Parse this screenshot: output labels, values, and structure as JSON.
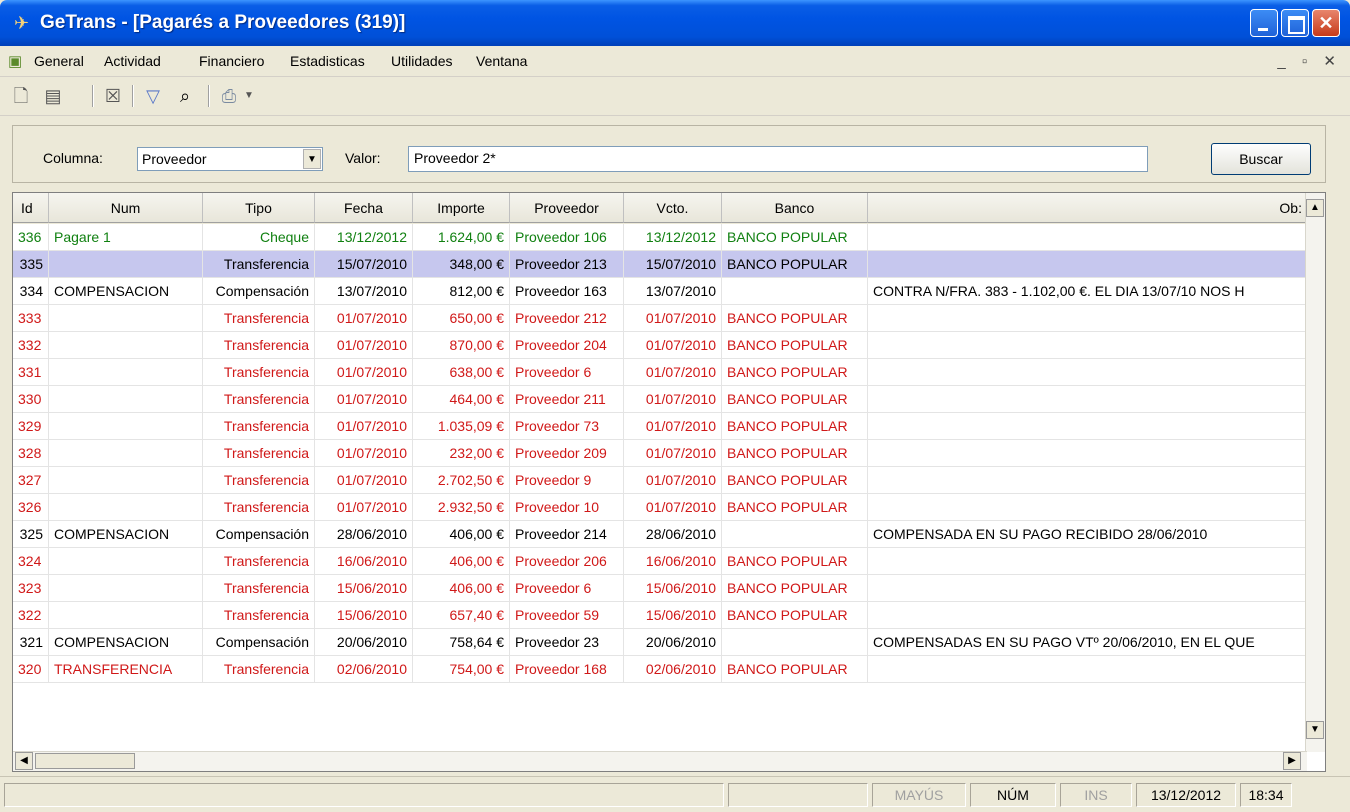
{
  "window": {
    "title": "GeTrans - [Pagarés a Proveedores (319)]"
  },
  "menu": [
    "General",
    "Actividad",
    "Financiero",
    "Estadisticas",
    "Utilidades",
    "Ventana"
  ],
  "search": {
    "column_label": "Columna:",
    "column_value": "Proveedor",
    "value_label": "Valor:",
    "value_text": "Proveedor 2*",
    "button": "Buscar"
  },
  "grid": {
    "headers": [
      "Id",
      "Num",
      "Tipo",
      "Fecha",
      "Importe",
      "Proveedor",
      "Vcto.",
      "Banco",
      "Ob:"
    ],
    "rows": [
      {
        "id": "336",
        "num": "Pagare 1",
        "tipo": "Cheque",
        "fecha": "13/12/2012",
        "importe": "1.624,00 €",
        "proveedor": "Proveedor 106",
        "vcto": "13/12/2012",
        "banco": "BANCO POPULAR",
        "obs": "",
        "color": "green"
      },
      {
        "id": "335",
        "num": "",
        "tipo": "Transferencia",
        "fecha": "15/07/2010",
        "importe": "348,00 €",
        "proveedor": "Proveedor 213",
        "vcto": "15/07/2010",
        "banco": "BANCO POPULAR",
        "obs": "",
        "color": "black",
        "selected": true
      },
      {
        "id": "334",
        "num": "COMPENSACION",
        "tipo": "Compensación",
        "fecha": "13/07/2010",
        "importe": "812,00 €",
        "proveedor": "Proveedor 163",
        "vcto": "13/07/2010",
        "banco": "",
        "obs": "CONTRA N/FRA. 383 - 1.102,00 €. EL DIA 13/07/10 NOS H",
        "color": "black"
      },
      {
        "id": "333",
        "num": "",
        "tipo": "Transferencia",
        "fecha": "01/07/2010",
        "importe": "650,00 €",
        "proveedor": "Proveedor 212",
        "vcto": "01/07/2010",
        "banco": "BANCO POPULAR",
        "obs": "",
        "color": "red"
      },
      {
        "id": "332",
        "num": "",
        "tipo": "Transferencia",
        "fecha": "01/07/2010",
        "importe": "870,00 €",
        "proveedor": "Proveedor 204",
        "vcto": "01/07/2010",
        "banco": "BANCO POPULAR",
        "obs": "",
        "color": "red"
      },
      {
        "id": "331",
        "num": "",
        "tipo": "Transferencia",
        "fecha": "01/07/2010",
        "importe": "638,00 €",
        "proveedor": "Proveedor 6",
        "vcto": "01/07/2010",
        "banco": "BANCO POPULAR",
        "obs": "",
        "color": "red"
      },
      {
        "id": "330",
        "num": "",
        "tipo": "Transferencia",
        "fecha": "01/07/2010",
        "importe": "464,00 €",
        "proveedor": "Proveedor 211",
        "vcto": "01/07/2010",
        "banco": "BANCO POPULAR",
        "obs": "",
        "color": "red"
      },
      {
        "id": "329",
        "num": "",
        "tipo": "Transferencia",
        "fecha": "01/07/2010",
        "importe": "1.035,09 €",
        "proveedor": "Proveedor 73",
        "vcto": "01/07/2010",
        "banco": "BANCO POPULAR",
        "obs": "",
        "color": "red"
      },
      {
        "id": "328",
        "num": "",
        "tipo": "Transferencia",
        "fecha": "01/07/2010",
        "importe": "232,00 €",
        "proveedor": "Proveedor 209",
        "vcto": "01/07/2010",
        "banco": "BANCO POPULAR",
        "obs": "",
        "color": "red"
      },
      {
        "id": "327",
        "num": "",
        "tipo": "Transferencia",
        "fecha": "01/07/2010",
        "importe": "2.702,50 €",
        "proveedor": "Proveedor 9",
        "vcto": "01/07/2010",
        "banco": "BANCO POPULAR",
        "obs": "",
        "color": "red"
      },
      {
        "id": "326",
        "num": "",
        "tipo": "Transferencia",
        "fecha": "01/07/2010",
        "importe": "2.932,50 €",
        "proveedor": "Proveedor 10",
        "vcto": "01/07/2010",
        "banco": "BANCO POPULAR",
        "obs": "",
        "color": "red"
      },
      {
        "id": "325",
        "num": "COMPENSACION",
        "tipo": "Compensación",
        "fecha": "28/06/2010",
        "importe": "406,00 €",
        "proveedor": "Proveedor 214",
        "vcto": "28/06/2010",
        "banco": "",
        "obs": "COMPENSADA EN SU PAGO RECIBIDO 28/06/2010",
        "color": "black"
      },
      {
        "id": "324",
        "num": "",
        "tipo": "Transferencia",
        "fecha": "16/06/2010",
        "importe": "406,00 €",
        "proveedor": "Proveedor 206",
        "vcto": "16/06/2010",
        "banco": "BANCO POPULAR",
        "obs": "",
        "color": "red"
      },
      {
        "id": "323",
        "num": "",
        "tipo": "Transferencia",
        "fecha": "15/06/2010",
        "importe": "406,00 €",
        "proveedor": "Proveedor 6",
        "vcto": "15/06/2010",
        "banco": "BANCO POPULAR",
        "obs": "",
        "color": "red"
      },
      {
        "id": "322",
        "num": "",
        "tipo": "Transferencia",
        "fecha": "15/06/2010",
        "importe": "657,40 €",
        "proveedor": "Proveedor 59",
        "vcto": "15/06/2010",
        "banco": "BANCO POPULAR",
        "obs": "",
        "color": "red"
      },
      {
        "id": "321",
        "num": "COMPENSACION",
        "tipo": "Compensación",
        "fecha": "20/06/2010",
        "importe": "758,64 €",
        "proveedor": "Proveedor 23",
        "vcto": "20/06/2010",
        "banco": "",
        "obs": "COMPENSADAS EN SU PAGO VTº 20/06/2010, EN EL QUE",
        "color": "black"
      },
      {
        "id": "320",
        "num": "TRANSFERENCIA",
        "tipo": "Transferencia",
        "fecha": "02/06/2010",
        "importe": "754,00 €",
        "proveedor": "Proveedor 168",
        "vcto": "02/06/2010",
        "banco": "BANCO POPULAR",
        "obs": "",
        "color": "red"
      }
    ]
  },
  "status": {
    "caps": "MAYÚS",
    "num": "NÚM",
    "ins": "INS",
    "date": "13/12/2012",
    "time": "18:34"
  },
  "icons": [
    "new-icon",
    "properties-icon",
    "delete-icon",
    "filter-icon",
    "find-icon",
    "print-icon",
    "dropdown-arrow-icon"
  ]
}
